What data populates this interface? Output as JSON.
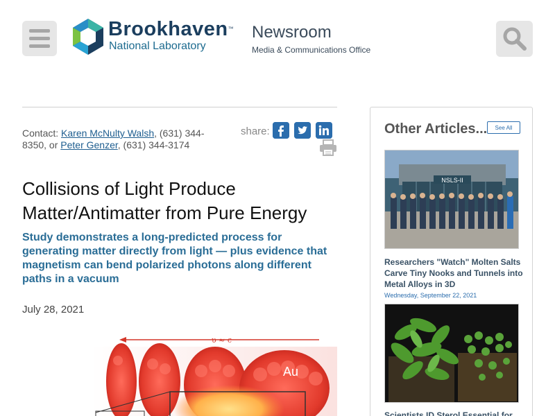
{
  "header": {
    "logo_name": "Brookhaven",
    "logo_tm": "™",
    "logo_sub": "National Laboratory",
    "section_title": "Newsroom",
    "section_subtitle": "Media & Communications Office",
    "menu_icon": "hamburger-icon",
    "search_icon": "search-icon"
  },
  "article": {
    "contact_prefix": "Contact: ",
    "contact1_name": "Karen McNulty Walsh",
    "contact1_phone": ", (631) 344-8350, or ",
    "contact2_name": "Peter Genzer",
    "contact2_phone": ", (631) 344-3174",
    "share_label": "share:",
    "share_icons": [
      "facebook-icon",
      "twitter-icon",
      "linkedin-icon"
    ],
    "title": "Collisions of Light Produce Matter/Antimatter from Pure Energy",
    "subtitle": "Study demonstrates a long-predicted process for generating matter directly from light — plus evidence that magnetism can bend polarized photons along different paths in a vacuum",
    "date": "July 28, 2021",
    "figure_velocity": "υ ≈ c",
    "figure_label": "Au"
  },
  "sidebar": {
    "heading": "Other Articles...",
    "see_all": "See All",
    "articles": [
      {
        "image_sign": "NSLS-II",
        "title": "Researchers \"Watch\" Molten Salts Carve Tiny Nooks and Tunnels into Metal Alloys in 3D",
        "date": "Wednesday, September 22, 2021"
      },
      {
        "title": "Scientists ID Sterol Essential for"
      }
    ]
  },
  "colors": {
    "brand_dark": "#1b3e5e",
    "brand_link": "#1d5d8f",
    "subtitle_blue": "#2a6d96",
    "button_gray": "#e6e6e6"
  }
}
